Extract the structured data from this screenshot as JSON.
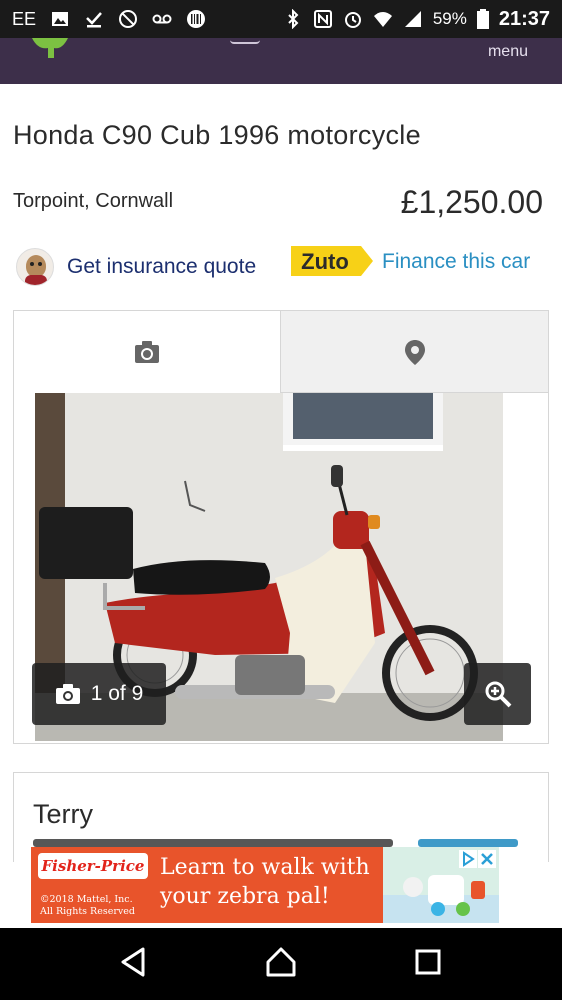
{
  "status_bar": {
    "carrier": "EE",
    "battery": "59%",
    "time": "21:37"
  },
  "header": {
    "menu_label": "menu"
  },
  "listing": {
    "title": "Honda C90 Cub 1996 motorcycle",
    "location": "Torpoint, Cornwall",
    "price": "£1,250.00"
  },
  "actions": {
    "insurance_label": "Get insurance quote",
    "zuto_brand": "Zuto",
    "finance_label": "Finance this car"
  },
  "gallery": {
    "tabs": [
      {
        "icon": "camera-icon",
        "selected": true
      },
      {
        "icon": "map-pin-icon",
        "selected": false
      }
    ],
    "counter": "1 of 9"
  },
  "seller": {
    "name": "Terry"
  },
  "ad": {
    "brand": "Fisher-Price",
    "headline_line1": "Learn to walk with",
    "headline_line2": "your zebra pal!",
    "copyright_line1": "©2018 Mattel, Inc.",
    "copyright_line2": "All Rights Reserved"
  },
  "colors": {
    "header_bg": "#3d2f4a",
    "brand_green": "#7cc142",
    "insurance_text": "#1c2f6f",
    "finance_text": "#2a8fc2",
    "zuto_yellow": "#f7d117",
    "ad_bg": "#e8542b"
  }
}
